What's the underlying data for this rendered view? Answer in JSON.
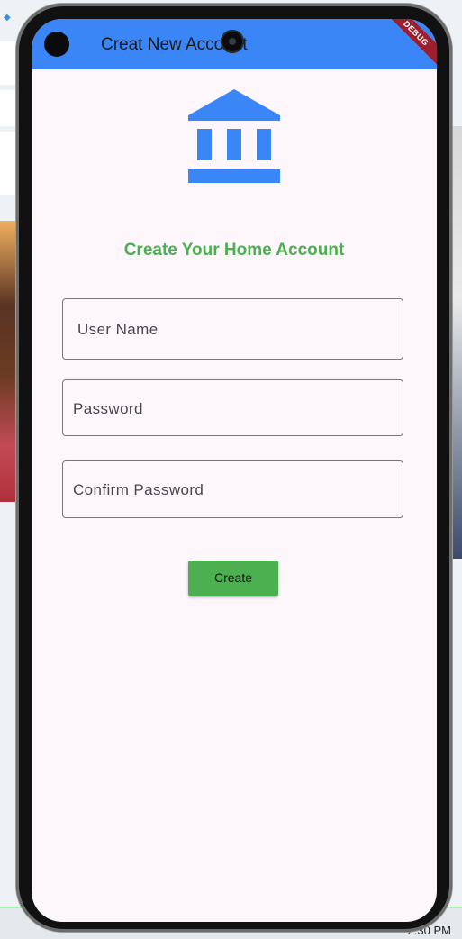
{
  "app": {
    "title": "Creat New Account",
    "debug_banner": "DEBUG"
  },
  "form": {
    "heading": "Create Your Home Account",
    "username_label": "User Name",
    "password_label": "Password",
    "confirm_password_label": "Confirm Password",
    "submit_label": "Create"
  },
  "system": {
    "time": "2:30 PM"
  },
  "colors": {
    "appbar": "#3b86f7",
    "icon": "#3b86f7",
    "heading": "#4caf50",
    "button": "#4caf50",
    "screen_bg": "#fdf7fc"
  },
  "icons": {
    "header": "bank-icon"
  }
}
